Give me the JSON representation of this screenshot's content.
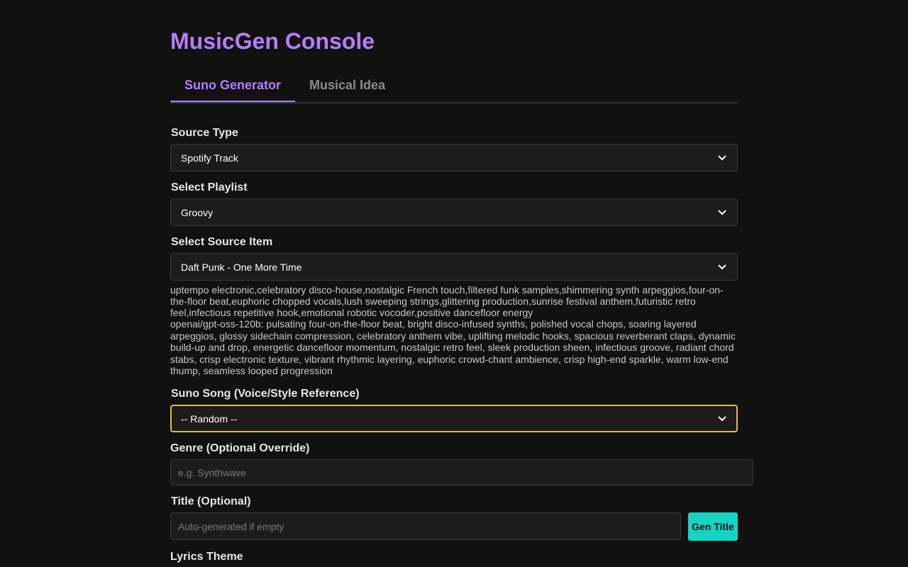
{
  "app": {
    "title": "MusicGen Console"
  },
  "tabs": [
    {
      "label": "Suno Generator",
      "active": true
    },
    {
      "label": "Musical Idea",
      "active": false
    }
  ],
  "form": {
    "source_type": {
      "label": "Source Type",
      "value": "Spotify Track"
    },
    "playlist": {
      "label": "Select Playlist",
      "value": "Groovy"
    },
    "source_item": {
      "label": "Select Source Item",
      "value": "Daft Punk - One More Time",
      "tags": "uptempo electronic,celebratory disco-house,nostalgic French touch,filtered funk samples,shimmering synth arpeggios,four-on-the-floor beat,euphoric chopped vocals,lush sweeping strings,glittering production,sunrise festival anthem,futuristic retro feel,infectious repetitive hook,emotional robotic vocoder,positive dancefloor energy",
      "ai_description": "openai/gpt-oss-120b: pulsating four-on-the-floor beat, bright disco-infused synths, polished vocal chops, soaring layered arpeggios, glossy sidechain compression, celebratory anthem vibe, uplifting melodic hooks, spacious reverberant claps, dynamic build-up and drop, energetic dancefloor momentum, nostalgic retro feel, sleek production sheen, infectious groove, radiant chord stabs, crisp electronic texture, vibrant rhythmic layering, euphoric crowd-chant ambience, crisp high-end sparkle, warm low-end thump, seamless looped progression"
    },
    "suno_song": {
      "label": "Suno Song (Voice/Style Reference)",
      "value": "-- Random --"
    },
    "genre": {
      "label": "Genre (Optional Override)",
      "value": "",
      "placeholder": "e.g. Synthwave"
    },
    "title": {
      "label": "Title (Optional)",
      "value": "",
      "placeholder": "Auto-generated if empty",
      "gen_button": "Gen Title"
    },
    "lyrics_theme": {
      "label": "Lyrics Theme"
    }
  },
  "colors": {
    "background": "#111111",
    "accent": "#b77cff",
    "button": "#14d4c4",
    "focus": "#e8b84a"
  },
  "icons": {
    "dropdown": "chevron-down-icon"
  }
}
